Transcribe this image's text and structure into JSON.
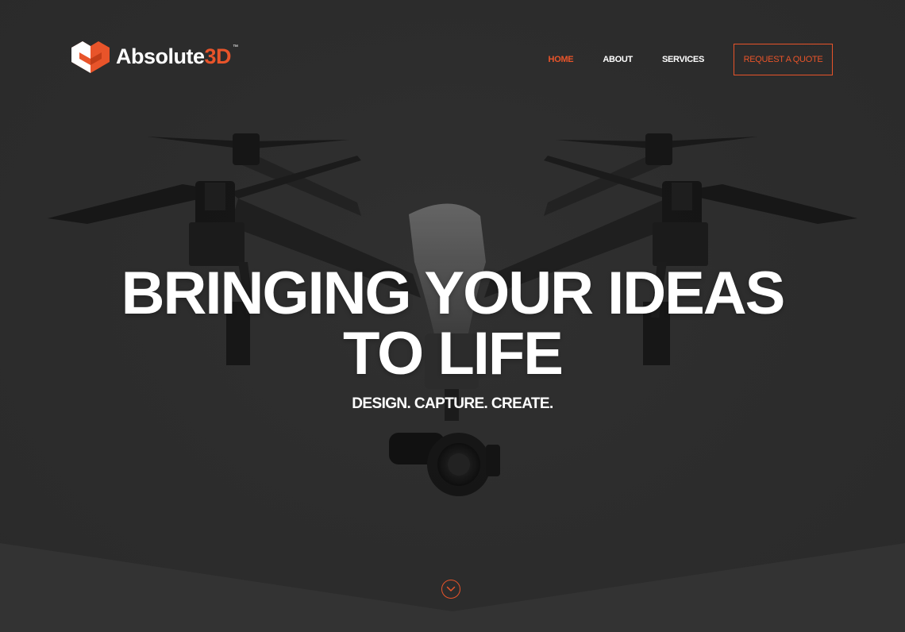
{
  "brand": {
    "name_main": "Absolute",
    "name_accent": "3D",
    "trademark": "™",
    "accent_color": "#e8542a"
  },
  "nav": {
    "items": [
      {
        "label": "HOME",
        "active": true
      },
      {
        "label": "ABOUT",
        "active": false
      },
      {
        "label": "SERVICES",
        "active": false
      }
    ],
    "cta_label": "REQUEST A QUOTE"
  },
  "hero": {
    "headline_line1": "BRINGING YOUR IDEAS",
    "headline_line2": "TO LIFE",
    "tagline": "DESIGN. CAPTURE. CREATE.",
    "background_image": "drone-photo",
    "scroll_icon": "chevron-down-circle-icon"
  }
}
